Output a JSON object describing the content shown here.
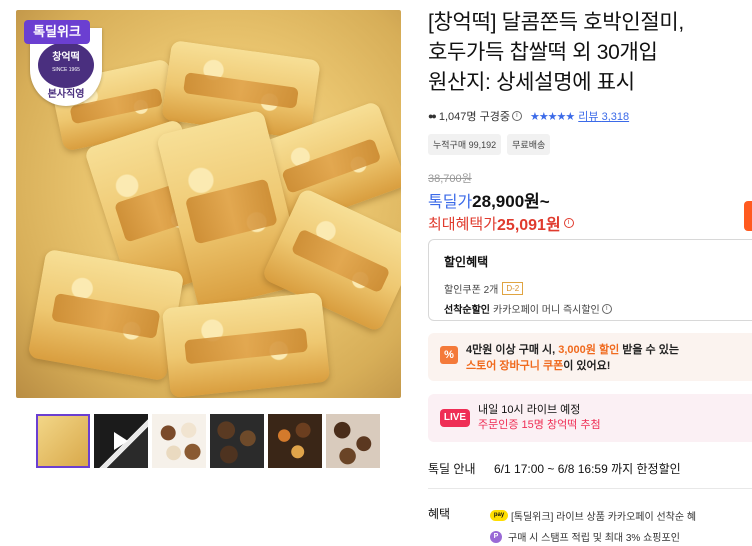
{
  "product": {
    "badge_week": "톡딜위크",
    "seal_name": "창억떡",
    "seal_since": "SINCE 1965",
    "seal_footer": "본사직영",
    "title_line1": "[창억떡] 달콤쫀득 호박인절미,",
    "title_line2": "호두가득 찹쌀떡 외 30개입",
    "title_line3": "원산지: 상세설명에 표시",
    "viewers": "1,047명 구경중",
    "stars": "★★★★★",
    "review_label": "리뷰",
    "review_count": "3,318",
    "tags": [
      "누적구매 99,192",
      "무료배송"
    ],
    "original_price": "38,700원",
    "sale_label": "톡딜가",
    "sale_price": "28,900원~",
    "max_label": "최대혜택가",
    "max_price": "25,091원",
    "thumbnails": [
      "photo-1",
      "video-2",
      "photo-3",
      "photo-4",
      "photo-5",
      "photo-6"
    ]
  },
  "discount": {
    "title": "할인혜택",
    "coupon_text": "할인쿠폰 2개",
    "coupon_badge": "D-2",
    "first_come_label": "선착순할인",
    "first_come_text": "카카오페이 머니 즉시할인"
  },
  "cart_banner": {
    "icon": "%",
    "line1_a": "4만원 이상 구매 시,",
    "line1_b": "3,000원 할인",
    "line1_c": "받을 수 있는",
    "line2_a": "스토어 장바구니 쿠폰",
    "line2_b": "이 있어요!"
  },
  "live": {
    "pill": "LIVE",
    "line1": "내일 10시 라이브 예정",
    "line2": "주문인증 15명 창억떡 추첨"
  },
  "deal": {
    "label": "톡딜 안내",
    "value": "6/1 17:00 ~ 6/8 16:59 까지 한정할인"
  },
  "benefit": {
    "label": "혜택",
    "pay_icon": "pay",
    "item1": "[톡딜위크] 라이브 상품 카카오페이 선착순 혜",
    "p_icon": "P",
    "item2": "구매 시 스탬프 적립 및 최대 3% 쇼핑포인"
  },
  "colors": {
    "brand_purple": "#6b3fd1",
    "accent_blue": "#3b6ae8",
    "price_red": "#e03b2e",
    "live_pink": "#ef2e55",
    "cart_orange": "#f06a1e"
  }
}
